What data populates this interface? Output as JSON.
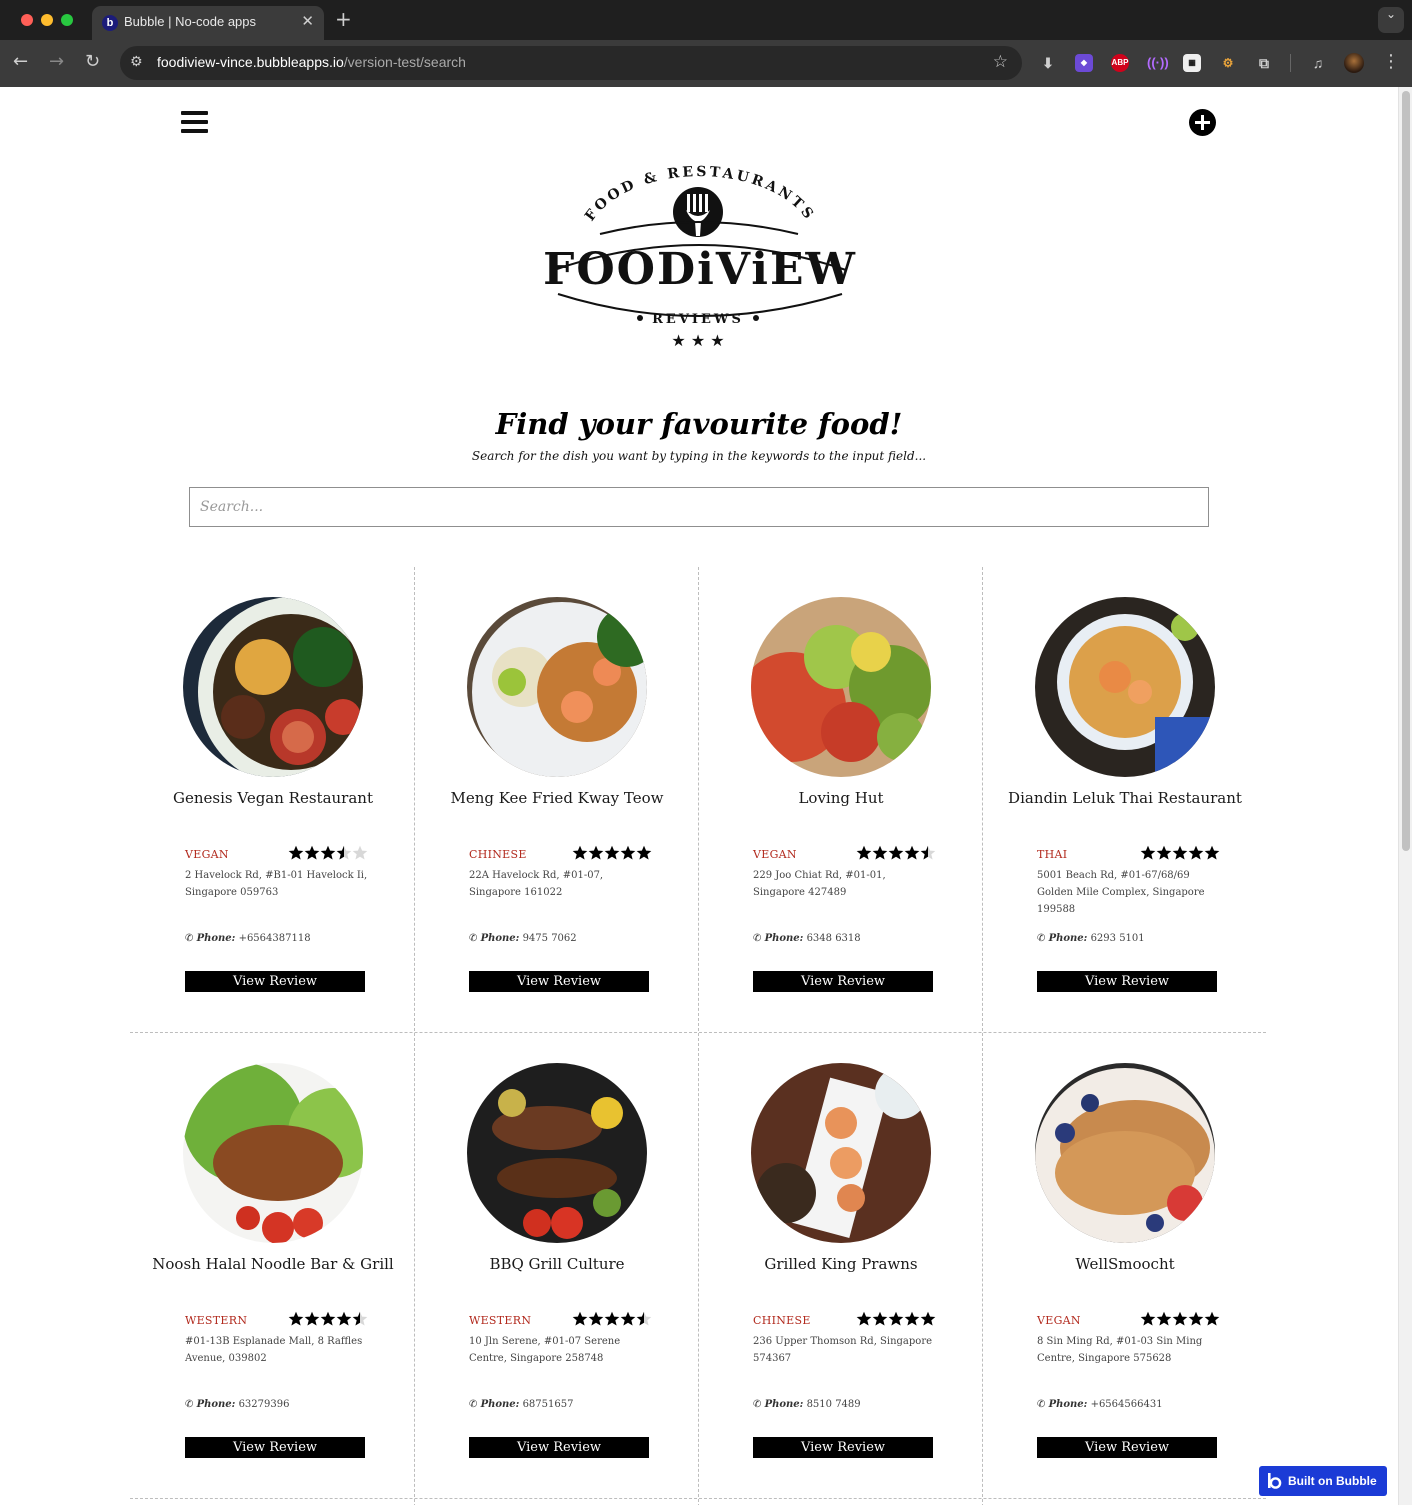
{
  "browser": {
    "tab_title": "Bubble | No-code apps",
    "tab_close": "✕",
    "new_tab": "+",
    "url_host": "foodiview-vince.bubbleapps.io",
    "url_path": "/version-test/search",
    "extensions": [
      "download-icon",
      "shield-extension-icon",
      "adblock-plus-icon",
      "broadcast-extension-icon",
      "qr-code-icon",
      "cookie-extension-icon",
      "puzzle-icon",
      "media-control-icon"
    ],
    "abp_label": "ABP"
  },
  "header": {
    "logo": {
      "top_arc": "FOOD & RESTAURANTS",
      "wordmark": "FOODiViEW",
      "bottom": "REVIEWS",
      "stars": "★ ★ ★"
    }
  },
  "hero": {
    "headline": "Find your favourite food!",
    "subline": "Search for the dish you want by typing in the keywords to the input field...",
    "search_placeholder": "Search..."
  },
  "labels": {
    "phone_label": "Phone:",
    "phone_icon": "✆",
    "view_review": "View Review"
  },
  "restaurants": [
    {
      "name": "Genesis Vegan Restaurant",
      "cuisine": "Vegan",
      "rating": 3.5,
      "address": "2 Havelock Rd, #B1-01 Havelock Ii, Singapore 059763",
      "phone": "+6564387118",
      "photo": "vegan-bowl-photo"
    },
    {
      "name": "Meng Kee Fried Kway Teow",
      "cuisine": "Chinese",
      "rating": 5,
      "address": "22A Havelock Rd, #01-07, Singapore 161022",
      "phone": "9475 7062",
      "photo": "pad-thai-photo"
    },
    {
      "name": "Loving Hut",
      "cuisine": "Vegan",
      "rating": 4.5,
      "address": "229 Joo Chiat Rd, #01-01, Singapore 427489",
      "phone": "6348 6318",
      "photo": "salad-photo"
    },
    {
      "name": "Diandin Leluk Thai Restaurant",
      "cuisine": "Thai",
      "rating": 5,
      "address": "5001 Beach Rd, #01-67/68/69 Golden Mile Complex, Singapore 199588",
      "phone": "6293 5101",
      "photo": "tom-yum-photo"
    },
    {
      "name": "Noosh Halal Noodle Bar & Grill",
      "cuisine": "Western",
      "rating": 4.5,
      "address": "#01-13B Esplanade Mall, 8 Raffles Avenue, 039802",
      "phone": "63279396",
      "photo": "grilled-chicken-photo"
    },
    {
      "name": "BBQ Grill Culture",
      "cuisine": "Western",
      "rating": 4.5,
      "address": "10 Jln Serene, #01-07 Serene Centre, Singapore 258748",
      "phone": "68751657",
      "photo": "bbq-grill-photo"
    },
    {
      "name": "Grilled King Prawns",
      "cuisine": "Chinese",
      "rating": 5,
      "address": "236 Upper Thomson Rd, Singapore 574367",
      "phone": "8510 7489",
      "photo": "prawns-photo"
    },
    {
      "name": "WellSmoocht",
      "cuisine": "Vegan",
      "rating": 5,
      "address": "8 Sin Ming Rd, #01-03 Sin Ming Centre, Singapore 575628",
      "phone": "+6564566431",
      "photo": "pancakes-photo"
    }
  ],
  "badge": {
    "text": "Built on Bubble"
  },
  "colors": {
    "accent_red": "#b22a1e",
    "button_black": "#000000",
    "badge_blue": "#1b3bd6"
  }
}
